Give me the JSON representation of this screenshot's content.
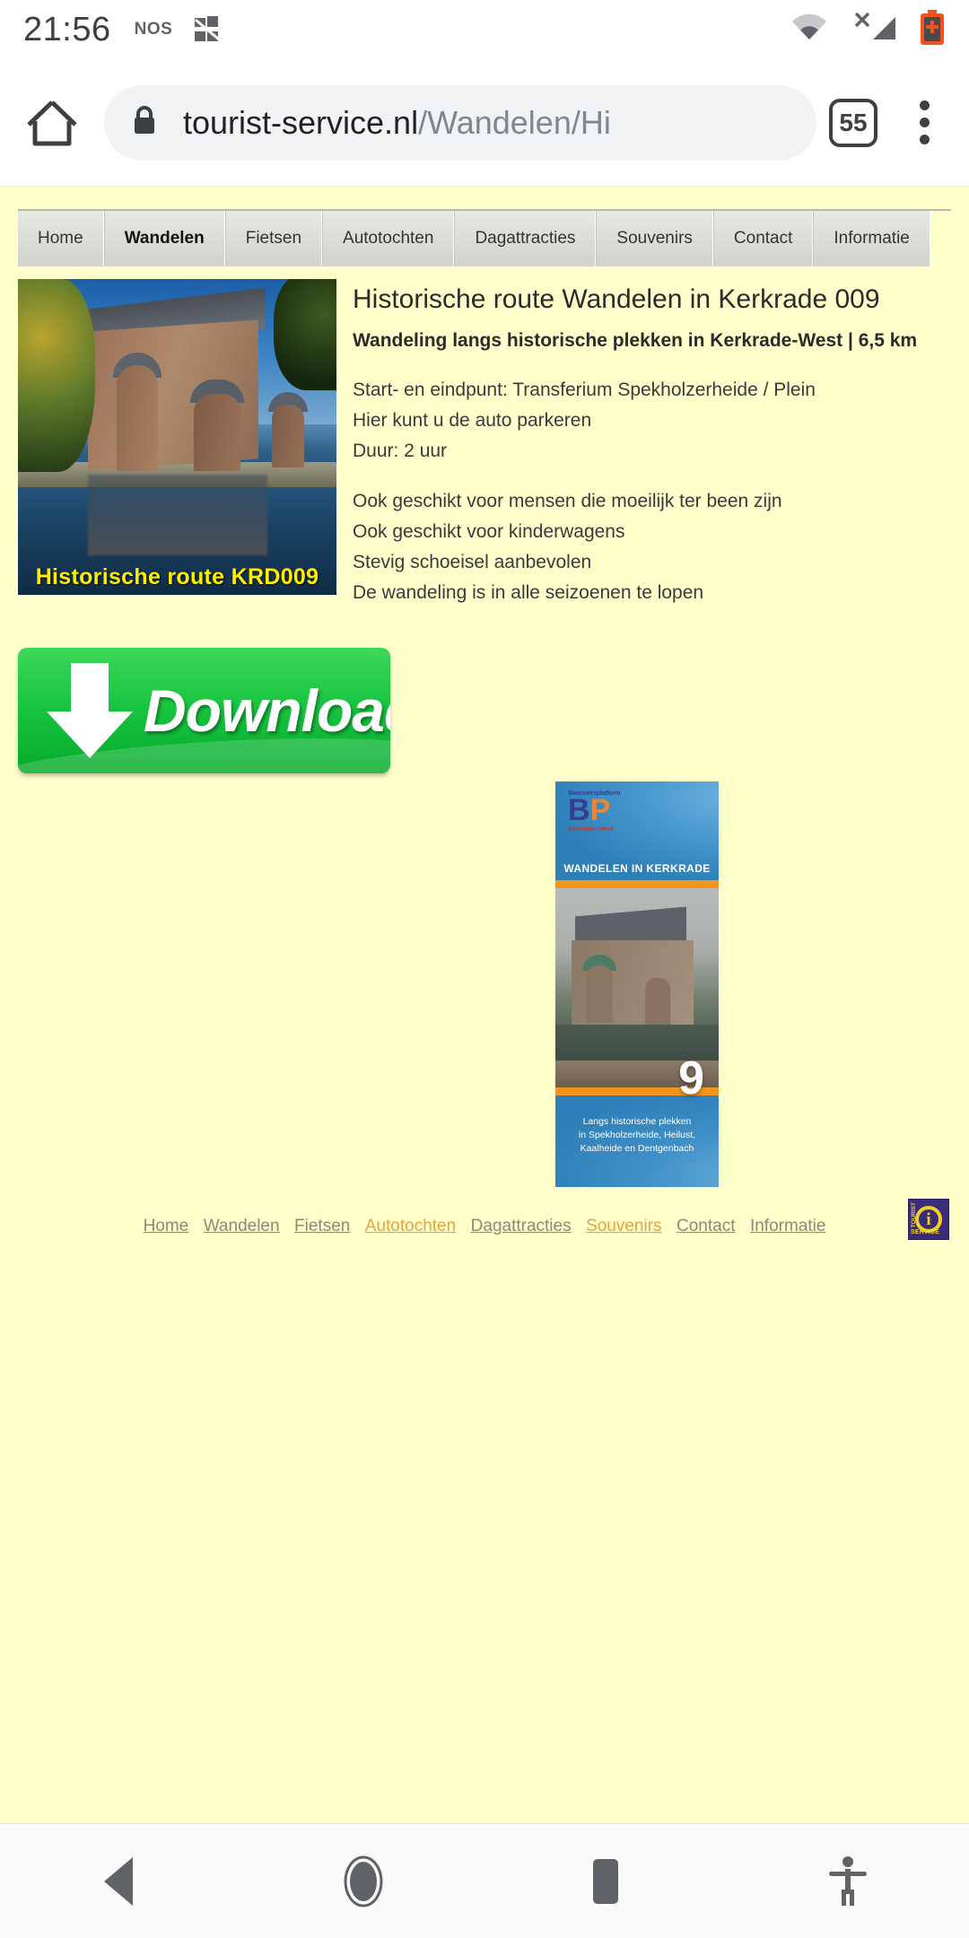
{
  "status_bar": {
    "time": "21:56",
    "notification_label": "NOS",
    "icons": [
      "app-notification-icon",
      "wifi-icon",
      "no-sim-icon",
      "battery-charging-icon"
    ]
  },
  "browser": {
    "home_icon": "home-icon",
    "lock_icon": "lock-icon",
    "url_domain": "tourist-service.nl",
    "url_path": "/Wandelen/Hi",
    "url_full": "tourist-service.nl/Wandelen/Hi",
    "tab_count": "55",
    "menu_icon": "three-dot-menu-icon"
  },
  "site_nav": {
    "tabs": [
      {
        "label": "Home",
        "active": false
      },
      {
        "label": "Wandelen",
        "active": true
      },
      {
        "label": "Fietsen",
        "active": false
      },
      {
        "label": "Autotochten",
        "active": false
      },
      {
        "label": "Dagattracties",
        "active": false
      },
      {
        "label": "Souvenirs",
        "active": false
      },
      {
        "label": "Contact",
        "active": false
      },
      {
        "label": "Informatie",
        "active": false
      }
    ]
  },
  "article": {
    "title": "Historische route Wandelen in Kerkrade 009",
    "subtitle": "Wandeling langs historische plekken in Kerkrade-West | 6,5 km",
    "paragraph_1_line_1": "Start- en eindpunt: Transferium Spekholzerheide / Plein",
    "paragraph_1_line_2": "Hier kunt u de auto parkeren",
    "paragraph_1_line_3": "Duur: 2 uur",
    "paragraph_2_line_1": "Ook geschikt voor mensen die moeilijk ter been zijn",
    "paragraph_2_line_2": "Ook geschikt voor kinderwagens",
    "paragraph_2_line_3": "Stevig schoeisel aanbevolen",
    "paragraph_2_line_4": "De wandeling is in alle seizoenen te lopen"
  },
  "photo": {
    "caption": "Historische route KRD009",
    "caption_color": "#ffee00",
    "alt": "kasteel-erenstein-photo"
  },
  "download_button": {
    "label": "Download",
    "bg_color": "#17c43f"
  },
  "brochure": {
    "logo_top_text": "Bewonersplatform",
    "logo_initials_b": "B",
    "logo_initials_p": "P",
    "logo_bottom_text": "Kerkrade-West",
    "header_title": "WANDELEN IN KERKRADE",
    "route_number": "9",
    "footer_line_1": "Langs historische plekken",
    "footer_line_2": "in Spekholzerheide, Heilust,",
    "footer_line_3": "Kaalheide en Dentgenbach",
    "accent_color": "#f2941d",
    "bg_color": "#2e7fb8"
  },
  "site_footer": {
    "links": [
      {
        "label": "Home",
        "highlighted": false
      },
      {
        "label": "Wandelen",
        "highlighted": false
      },
      {
        "label": "Fietsen",
        "highlighted": false
      },
      {
        "label": "Autotochten",
        "highlighted": true
      },
      {
        "label": "Dagattracties",
        "highlighted": false
      },
      {
        "label": "Souvenirs",
        "highlighted": true
      },
      {
        "label": "Contact",
        "highlighted": false
      },
      {
        "label": "Informatie",
        "highlighted": false
      }
    ],
    "badge": {
      "word_top": "TOURIST",
      "word_bottom": "SERVICE",
      "letter": "i"
    }
  },
  "android_nav": {
    "back": "back-button",
    "home": "home-button",
    "recents": "recents-button",
    "accessibility": "accessibility-button"
  },
  "theme": {
    "page_bg": "#ffffcc",
    "chrome_bg": "#ffffff"
  }
}
